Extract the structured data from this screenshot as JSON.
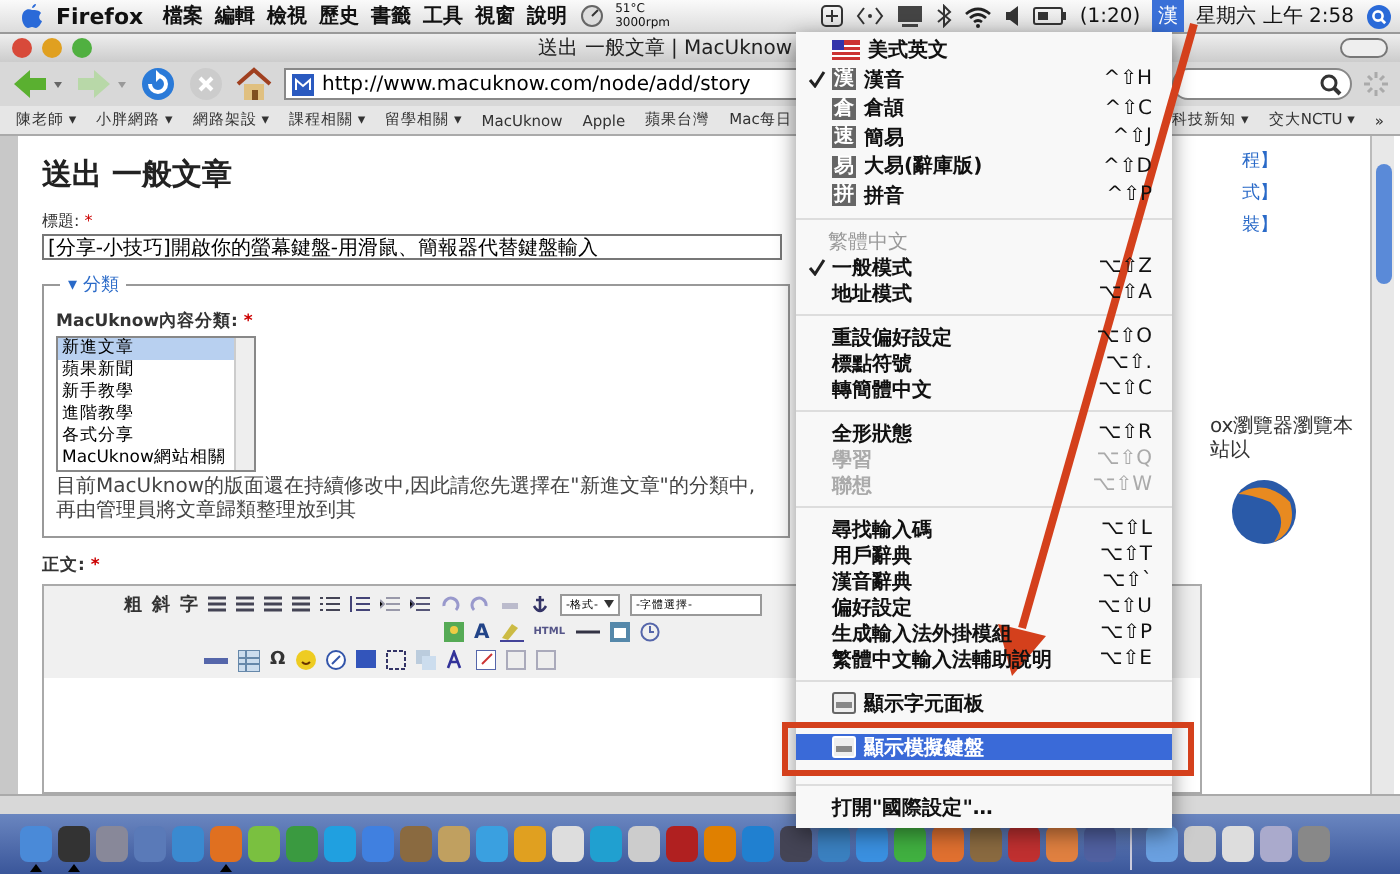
{
  "menu_bar": {
    "app_name": "Firefox",
    "items": [
      "檔案",
      "編輯",
      "檢視",
      "歷史",
      "書籤",
      "工具",
      "視窗",
      "說明"
    ],
    "temperature": "51°C",
    "fan_speed": "3000rpm",
    "battery": "(1:20)",
    "input_method": "漢",
    "clock": "星期六 上午 2:58"
  },
  "window": {
    "title": "送出 一般文章 | MacUknow"
  },
  "toolbar": {
    "url": "http://www.macuknow.com/node/add/story"
  },
  "bookmarks": [
    "陳老師 ▾",
    "小胖網路 ▾",
    "網路架設 ▾",
    "課程相關 ▾",
    "留學相關 ▾",
    "MacUknow",
    "Apple",
    "蘋果台灣",
    "Mac每日"
  ],
  "bookmarks_right": [
    "科技新知 ▾",
    "交大NCTU ▾"
  ],
  "bookmarks_more": "»",
  "page": {
    "heading": "送出 一般文章",
    "title_label": "標題:",
    "required_mark": "*",
    "title_value": "[分享-小技巧]開啟你的螢幕鍵盤-用滑鼠、簡報器代替鍵盤輸入",
    "fieldset_legend": "▾ 分類",
    "category_label": "MacUknow內容分類:",
    "categories": [
      {
        "label": "新進文章",
        "selected": true
      },
      {
        "label": "蘋果新聞",
        "selected": false
      },
      {
        "label": "新手教學",
        "selected": false
      },
      {
        "label": "進階教學",
        "selected": false
      },
      {
        "label": "各式分享",
        "selected": false
      },
      {
        "label": "MacUknow網站相關",
        "selected": false
      }
    ],
    "note": "目前MacUknow的版面還在持續修改中,因此請您先選擇在\"新進文章\"的分類中,再由管理員將文章歸類整理放到其",
    "body_label": "正文:",
    "editor": {
      "text_buttons": [
        "粗",
        "斜",
        "字"
      ],
      "format_select": "-格式-",
      "font_select": "-字體選擇-",
      "html_button": "HTML",
      "text_color_button": "A",
      "symbol_button": "Ω"
    }
  },
  "sidebar": {
    "links": [
      "程】",
      "式】",
      "裝】"
    ],
    "text": "ox瀏覽器瀏覽本站以"
  },
  "input_menu": [
    {
      "kind": "flag_item",
      "label": "美式英文",
      "checked": false,
      "selected": false,
      "disabled": false
    },
    {
      "kind": "method_item",
      "glyph": "漢",
      "label": "漢音",
      "shortcut": "^⇧H",
      "checked": true,
      "selected": false,
      "disabled": false
    },
    {
      "kind": "method_item",
      "glyph": "倉",
      "label": "倉頡",
      "shortcut": "^⇧C",
      "checked": false,
      "selected": false,
      "disabled": false
    },
    {
      "kind": "method_item",
      "glyph": "速",
      "label": "簡易",
      "shortcut": "^⇧J",
      "checked": false,
      "selected": false,
      "disabled": false
    },
    {
      "kind": "method_item",
      "glyph": "易",
      "label": "大易(辭庫版)",
      "shortcut": "^⇧D",
      "checked": false,
      "selected": false,
      "disabled": false
    },
    {
      "kind": "method_item",
      "glyph": "拼",
      "label": "拼音",
      "shortcut": "^⇧P",
      "checked": false,
      "selected": false,
      "disabled": false
    },
    {
      "kind": "separator"
    },
    {
      "kind": "header",
      "label": "繁體中文"
    },
    {
      "kind": "item",
      "label": "一般模式",
      "shortcut": "⌥⇧Z",
      "checked": true,
      "selected": false,
      "disabled": false
    },
    {
      "kind": "item",
      "label": "地址模式",
      "shortcut": "⌥⇧A",
      "checked": false,
      "selected": false,
      "disabled": false
    },
    {
      "kind": "separator"
    },
    {
      "kind": "item",
      "label": "重設偏好設定",
      "shortcut": "⌥⇧O",
      "checked": false,
      "selected": false,
      "disabled": false
    },
    {
      "kind": "item",
      "label": "標點符號",
      "shortcut": "⌥⇧.",
      "checked": false,
      "selected": false,
      "disabled": false
    },
    {
      "kind": "item",
      "label": "轉簡體中文",
      "shortcut": "⌥⇧C",
      "checked": false,
      "selected": false,
      "disabled": false
    },
    {
      "kind": "separator"
    },
    {
      "kind": "item",
      "label": "全形狀態",
      "shortcut": "⌥⇧R",
      "checked": false,
      "selected": false,
      "disabled": false
    },
    {
      "kind": "item",
      "label": "學習",
      "shortcut": "⌥⇧Q",
      "checked": false,
      "selected": false,
      "disabled": true
    },
    {
      "kind": "item",
      "label": "聯想",
      "shortcut": "⌥⇧W",
      "checked": false,
      "selected": false,
      "disabled": true
    },
    {
      "kind": "separator"
    },
    {
      "kind": "item",
      "label": "尋找輸入碼",
      "shortcut": "⌥⇧L",
      "checked": false,
      "selected": false,
      "disabled": false
    },
    {
      "kind": "item",
      "label": "用戶辭典",
      "shortcut": "⌥⇧T",
      "checked": false,
      "selected": false,
      "disabled": false
    },
    {
      "kind": "item",
      "label": "漢音辭典",
      "shortcut": "⌥⇧`",
      "checked": false,
      "selected": false,
      "disabled": false
    },
    {
      "kind": "item",
      "label": "偏好設定",
      "shortcut": "⌥⇧U",
      "checked": false,
      "selected": false,
      "disabled": false
    },
    {
      "kind": "item",
      "label": "生成輸入法外掛模組",
      "shortcut": "⌥⇧P",
      "checked": false,
      "selected": false,
      "disabled": false
    },
    {
      "kind": "item",
      "label": "繁體中文輸入法輔助說明",
      "shortcut": "⌥⇧E",
      "checked": false,
      "selected": false,
      "disabled": false
    },
    {
      "kind": "separator"
    },
    {
      "kind": "panel_item",
      "label": "顯示字元面板",
      "checked": false,
      "selected": false,
      "disabled": false
    },
    {
      "kind": "panel_item",
      "label": "顯示模擬鍵盤",
      "checked": false,
      "selected": true,
      "disabled": false
    },
    {
      "kind": "separator"
    },
    {
      "kind": "item",
      "label": "打開\"國際設定\"…",
      "checked": false,
      "selected": false,
      "disabled": false
    }
  ],
  "dock": {
    "apps": [
      {
        "running": true
      },
      {
        "running": true
      },
      {
        "running": false
      },
      {
        "running": false
      },
      {
        "running": false
      },
      {
        "running": true
      },
      {
        "running": false
      },
      {
        "running": false
      },
      {
        "running": false
      },
      {
        "running": false
      },
      {
        "running": false
      },
      {
        "running": false
      },
      {
        "running": false
      },
      {
        "running": false
      },
      {
        "running": false
      },
      {
        "running": false
      },
      {
        "running": false
      },
      {
        "running": false
      },
      {
        "running": false
      },
      {
        "running": false
      },
      {
        "running": false
      },
      {
        "running": false
      },
      {
        "running": false
      },
      {
        "running": false
      },
      {
        "running": false
      },
      {
        "running": false
      },
      {
        "running": false
      },
      {
        "running": false
      },
      {
        "running": false
      }
    ],
    "stacks": [
      {
        "running": false
      },
      {
        "running": false
      },
      {
        "running": false
      },
      {
        "running": false
      },
      {
        "running": false
      }
    ]
  }
}
